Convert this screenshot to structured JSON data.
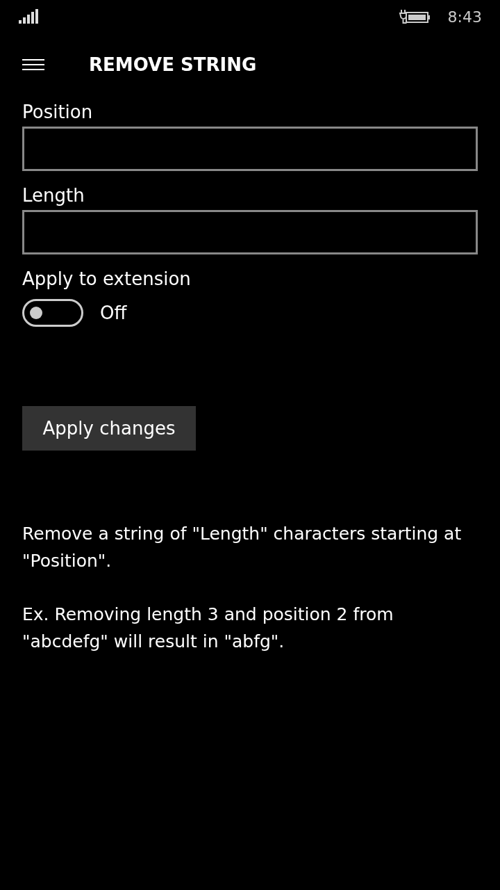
{
  "status_bar": {
    "time": "8:43"
  },
  "header": {
    "title": "REMOVE STRING"
  },
  "fields": [
    {
      "label": "Position"
    },
    {
      "label": "Length"
    }
  ],
  "toggle": {
    "label": "Apply to extension",
    "on": false,
    "state_text": "Off"
  },
  "button": {
    "label": "Apply changes"
  },
  "paragraphs": [
    "Remove a string of \"Length\" characters starting at \"Position\".",
    "Ex. Removing length 3 and position 2 from \"abcdefg\" will result in \"abfg\"."
  ]
}
